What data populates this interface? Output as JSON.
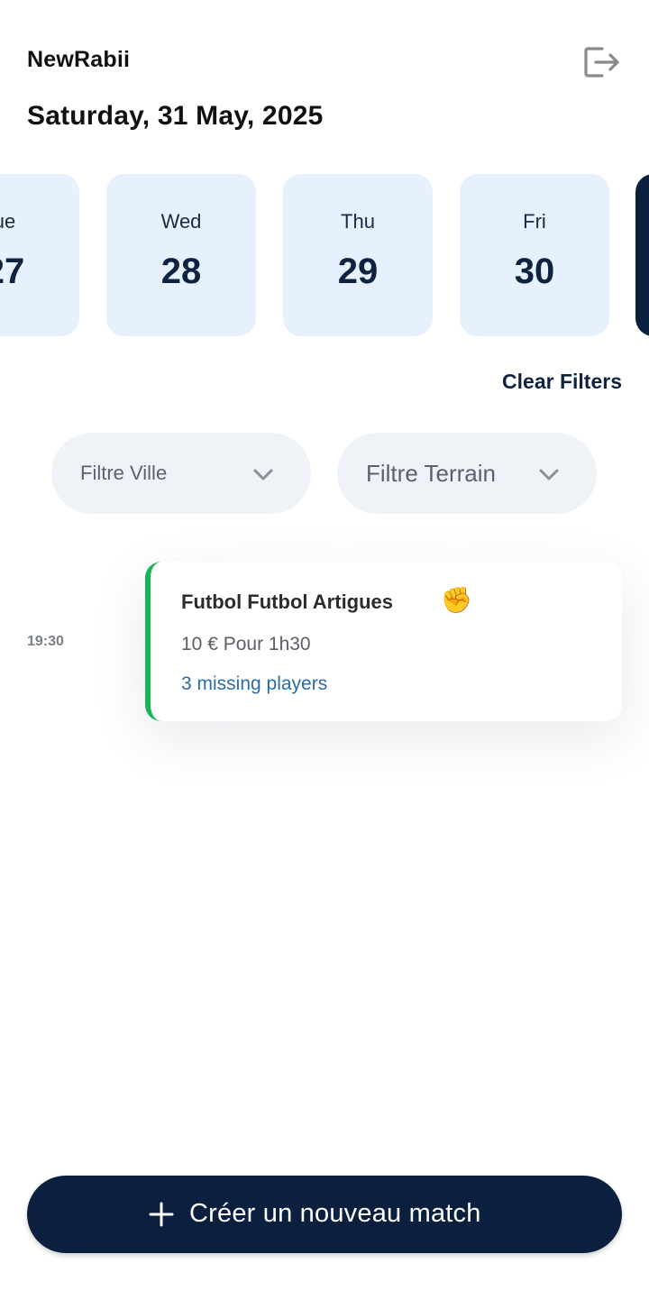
{
  "header": {
    "username": "NewRabii",
    "date": "Saturday, 31 May, 2025",
    "logout_icon": "logout-icon"
  },
  "days": [
    {
      "dow": "ue",
      "num": "27"
    },
    {
      "dow": "Wed",
      "num": "28"
    },
    {
      "dow": "Thu",
      "num": "29"
    },
    {
      "dow": "Fri",
      "num": "30"
    }
  ],
  "filters": {
    "clear_label": "Clear Filters",
    "city_placeholder": "Filtre Ville",
    "terrain_placeholder": "Filtre Terrain"
  },
  "matches": [
    {
      "time": "19:30",
      "title": "Futbol Futbol Artigues",
      "emoji": "✊",
      "price": "10 € Pour 1h30",
      "missing": "3 missing players"
    }
  ],
  "actions": {
    "create_label": "Créer un nouveau match"
  },
  "colors": {
    "navy": "#0b1f3f",
    "card_bg": "#e7f1fd",
    "filter_bg": "#eff2f7",
    "accent_green": "#19b35a",
    "link_blue": "#2a6ca8"
  }
}
